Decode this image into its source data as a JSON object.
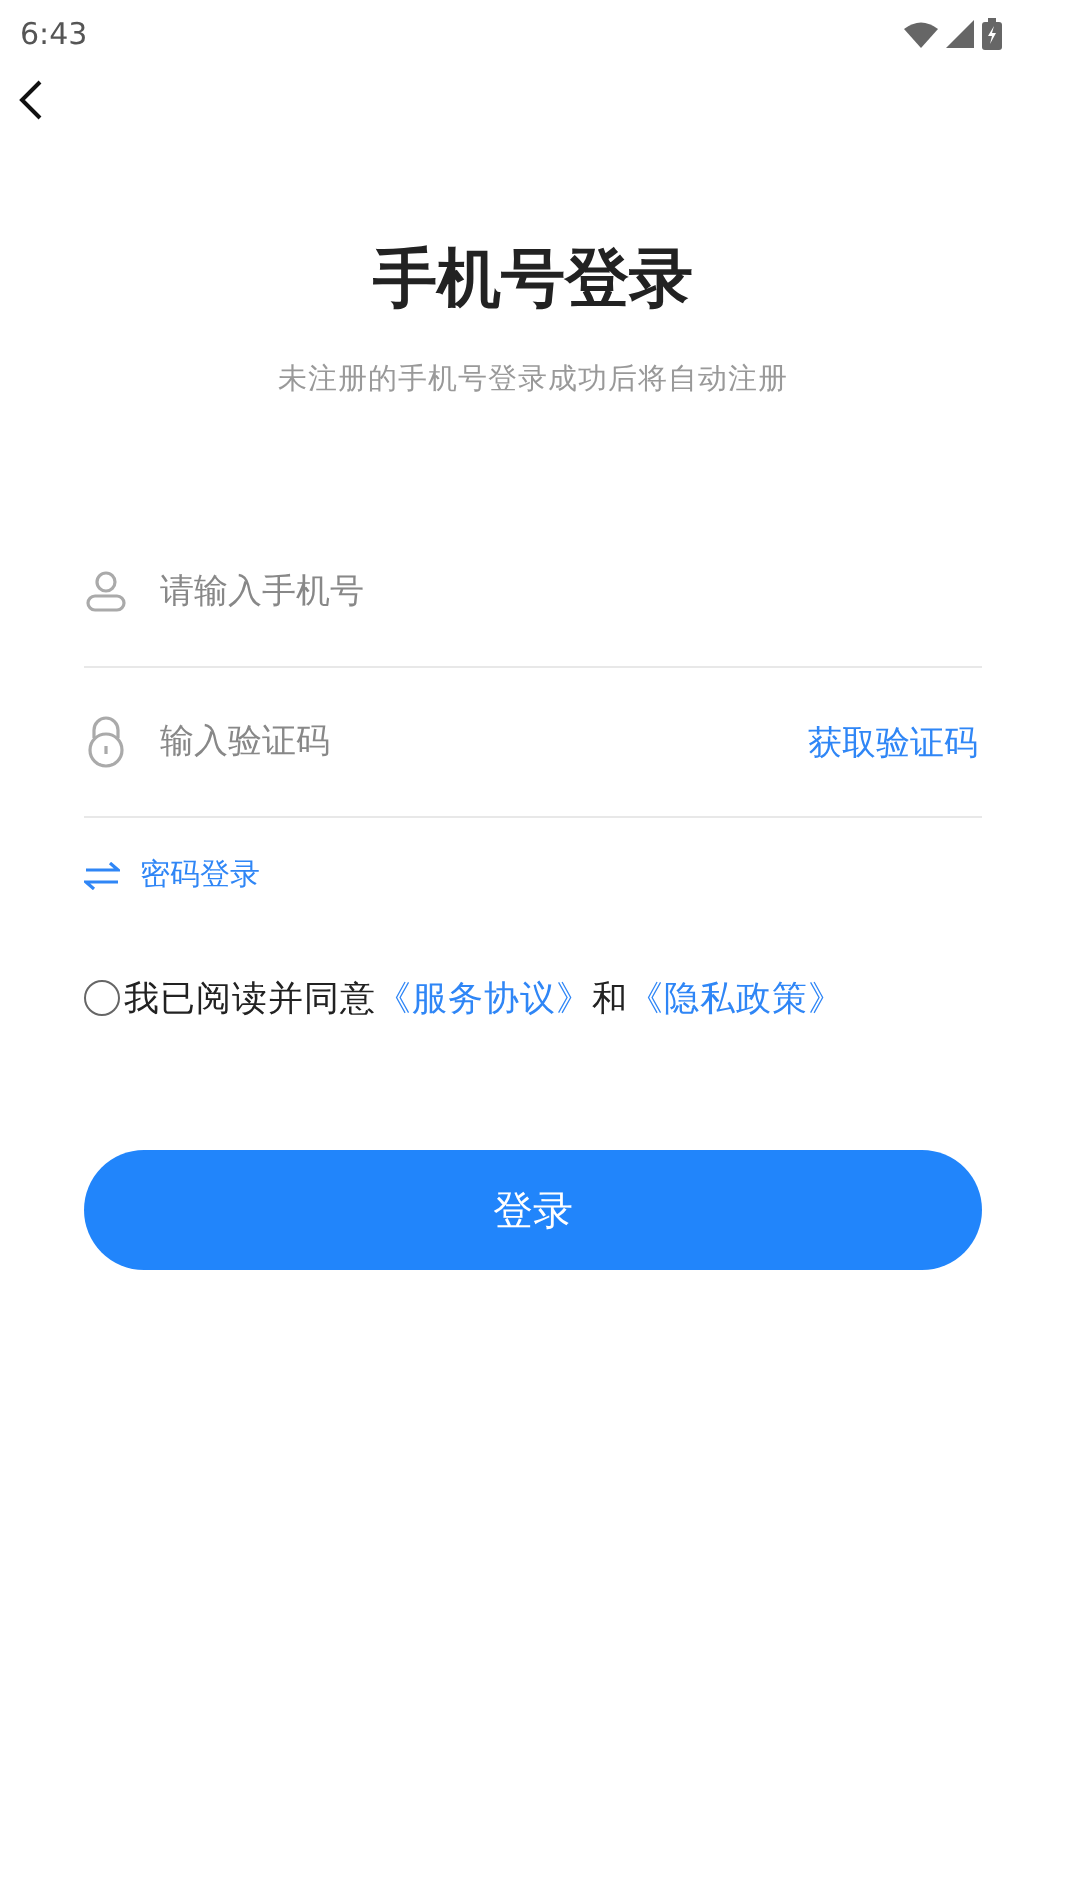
{
  "status_bar": {
    "time": "6:43"
  },
  "title": "手机号登录",
  "subtitle": "未注册的手机号登录成功后将自动注册",
  "phone_field": {
    "placeholder": "请输入手机号"
  },
  "code_field": {
    "placeholder": "输入验证码",
    "action": "获取验证码"
  },
  "switch_link": "密码登录",
  "agreement": {
    "checked": false,
    "text": "我已阅读并同意",
    "links": [
      "《服务协议》",
      "《隐私政策》"
    ],
    "joiner": "和"
  },
  "login_button": "登录"
}
